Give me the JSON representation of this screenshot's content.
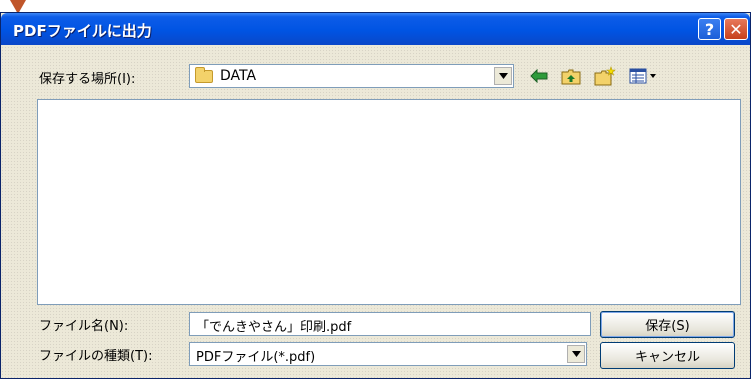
{
  "window": {
    "title": "PDFファイルに出力"
  },
  "titlebar": {
    "help_symbol": "?",
    "close_symbol": "✕"
  },
  "location": {
    "label": "保存する場所(I):",
    "value": "DATA"
  },
  "filename": {
    "label": "ファイル名(N):",
    "value": "「でんきやさん」印刷.pdf"
  },
  "filetype": {
    "label": "ファイルの種類(T):",
    "value": "PDFファイル(*.pdf)"
  },
  "buttons": {
    "save": "保存(S)",
    "cancel": "キャンセル"
  },
  "icons": [
    "folder-icon",
    "back-arrow-icon",
    "up-folder-icon",
    "new-folder-icon",
    "view-menu-icon",
    "chevron-down-icon"
  ],
  "colors": {
    "titlebar": "#0054e3",
    "dialog": "#ece9d8",
    "field_border": "#7f9db9"
  }
}
